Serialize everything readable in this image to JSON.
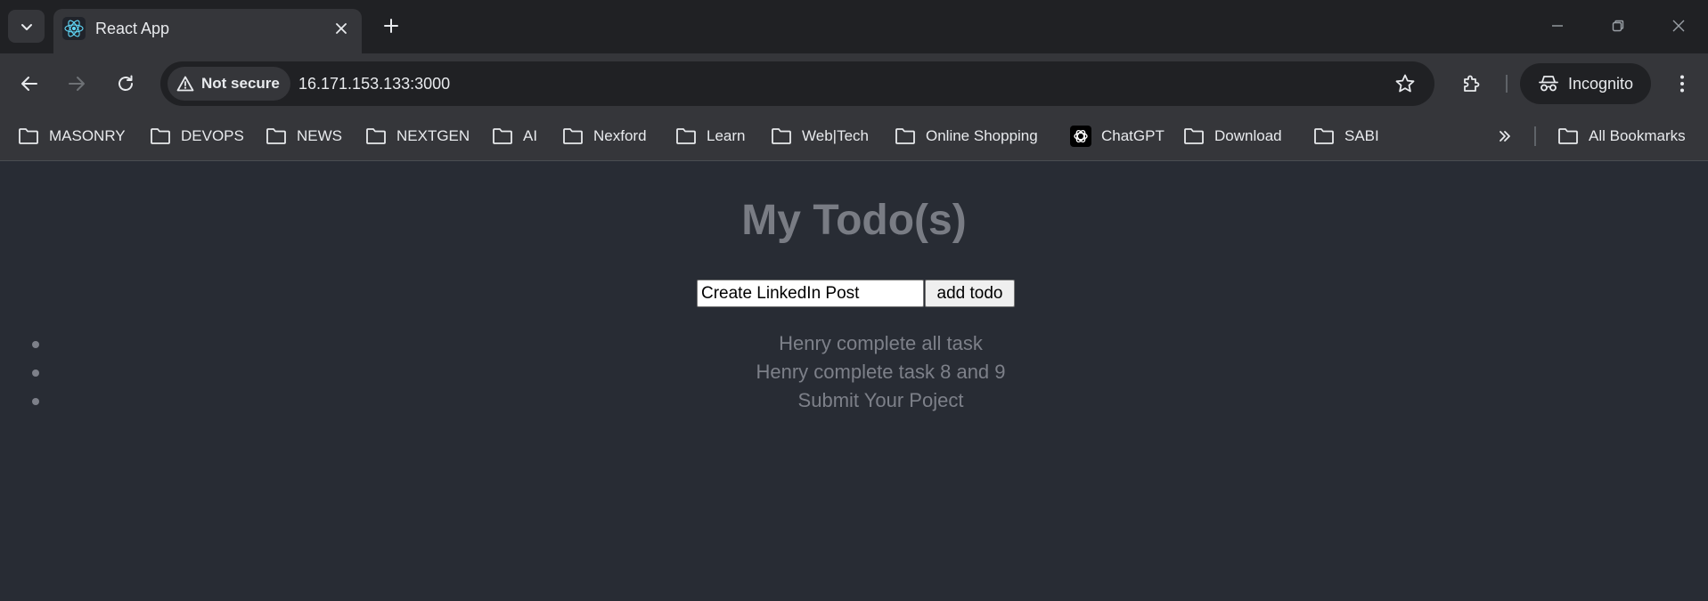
{
  "browser": {
    "tab": {
      "title": "React App",
      "favicon": "react-logo-icon"
    },
    "address_bar": {
      "security_label": "Not secure",
      "url": "16.171.153.133:3000"
    },
    "profile_label": "Incognito",
    "bookmarks": [
      {
        "label": "MASONRY",
        "icon": "folder-icon"
      },
      {
        "label": "DEVOPS",
        "icon": "folder-icon"
      },
      {
        "label": "NEWS",
        "icon": "folder-icon"
      },
      {
        "label": "NEXTGEN",
        "icon": "folder-icon"
      },
      {
        "label": "AI",
        "icon": "folder-icon"
      },
      {
        "label": "Nexford",
        "icon": "folder-icon"
      },
      {
        "label": "Learn",
        "icon": "folder-icon"
      },
      {
        "label": "Web|Tech",
        "icon": "folder-icon"
      },
      {
        "label": "Online Shopping",
        "icon": "folder-icon"
      },
      {
        "label": "ChatGPT",
        "icon": "chatgpt-icon"
      },
      {
        "label": "Download",
        "icon": "folder-icon"
      },
      {
        "label": "SABI",
        "icon": "folder-icon"
      }
    ],
    "all_bookmarks_label": "All Bookmarks"
  },
  "app": {
    "heading": "My Todo(s)",
    "input": {
      "value": "Create LinkedIn Post"
    },
    "add_button_label": "add todo",
    "todos": [
      "Henry complete all task",
      "Henry complete task 8 and 9",
      "Submit Your Poject"
    ]
  },
  "colors": {
    "page_bg": "#282c34",
    "chrome_bg": "#202124",
    "toolbar_bg": "#35363a",
    "heading_text": "#797c84",
    "todo_text": "#7d8089"
  }
}
